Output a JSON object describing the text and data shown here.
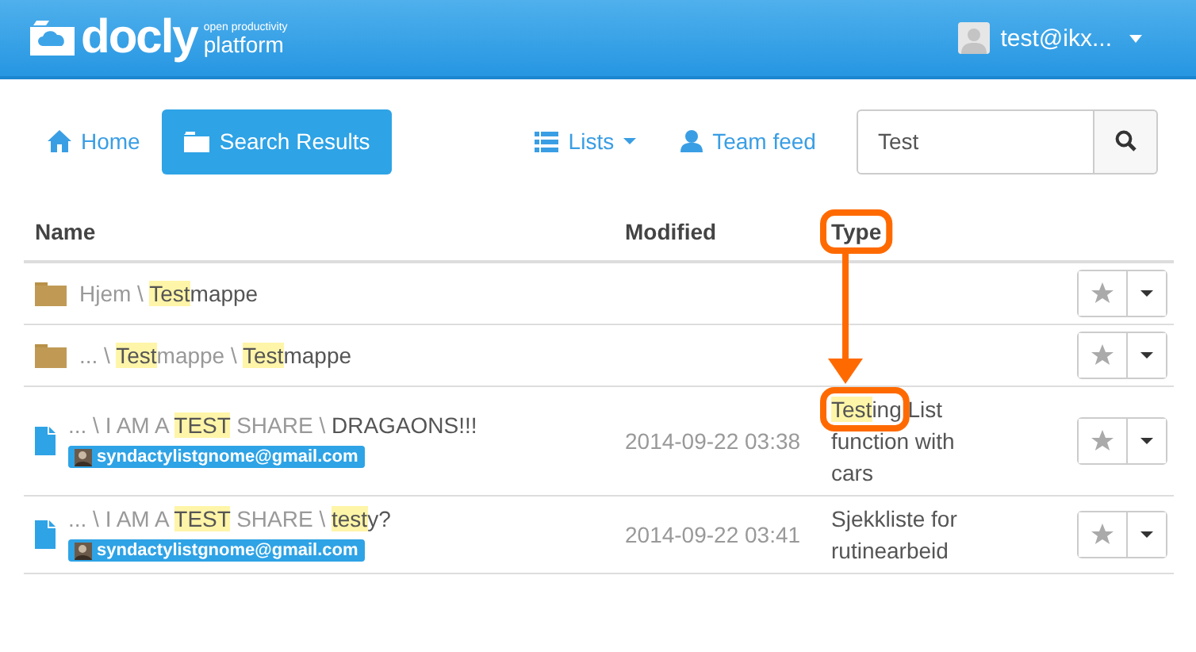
{
  "header": {
    "logo": {
      "name": "docly",
      "tagline_top": "open productivity",
      "tagline_bottom": "platform"
    },
    "user": "test@ikx..."
  },
  "nav": {
    "items": [
      {
        "kind": "link",
        "label": "Home",
        "selected": false
      },
      {
        "kind": "link",
        "label": "Search Results",
        "selected": true
      },
      {
        "kind": "dropdown",
        "label": "Lists",
        "selected": false
      },
      {
        "kind": "link",
        "label": "Team feed",
        "selected": false
      }
    ],
    "search": {
      "value": "Test"
    }
  },
  "table": {
    "columns": [
      "Name",
      "Modified",
      "Type"
    ],
    "rows": [
      {
        "kind": "folder",
        "name": [
          {
            "kind": "path",
            "text": "Hjem \\ "
          },
          {
            "kind": "match",
            "text": "Test"
          },
          {
            "kind": "name",
            "text": "mappe"
          }
        ],
        "owner": null,
        "modified": null,
        "type": null,
        "starred": false
      },
      {
        "kind": "folder",
        "name": [
          {
            "kind": "path",
            "text": "... \\ "
          },
          {
            "kind": "match",
            "text": "Test"
          },
          {
            "kind": "path",
            "text": "mappe \\ "
          },
          {
            "kind": "match",
            "text": "Test"
          },
          {
            "kind": "name",
            "text": "mappe"
          }
        ],
        "owner": null,
        "modified": null,
        "type": null,
        "starred": false
      },
      {
        "kind": "document",
        "name": [
          {
            "kind": "path",
            "text": "... \\ I AM A "
          },
          {
            "kind": "match",
            "text": "TEST"
          },
          {
            "kind": "path",
            "text": " SHARE \\ "
          },
          {
            "kind": "name",
            "text": "DRAGAONS!!!"
          }
        ],
        "owner": "syndactylistgnome@gmail.com",
        "modified": "2014-09-22 03:38",
        "type": [
          {
            "kind": "match",
            "text": "Test"
          },
          {
            "kind": "name",
            "text": "ing List function with cars"
          }
        ],
        "starred": false
      },
      {
        "kind": "document",
        "name": [
          {
            "kind": "path",
            "text": "... \\ I AM A "
          },
          {
            "kind": "match",
            "text": "TEST"
          },
          {
            "kind": "path",
            "text": " SHARE \\ "
          },
          {
            "kind": "match",
            "text": "test"
          },
          {
            "kind": "name",
            "text": "y?"
          }
        ],
        "owner": "syndactylistgnome@gmail.com",
        "modified": "2014-09-22 03:41",
        "type": [
          {
            "kind": "name",
            "text": "Sjekkliste for rutinearbeid"
          }
        ],
        "starred": false
      }
    ]
  }
}
